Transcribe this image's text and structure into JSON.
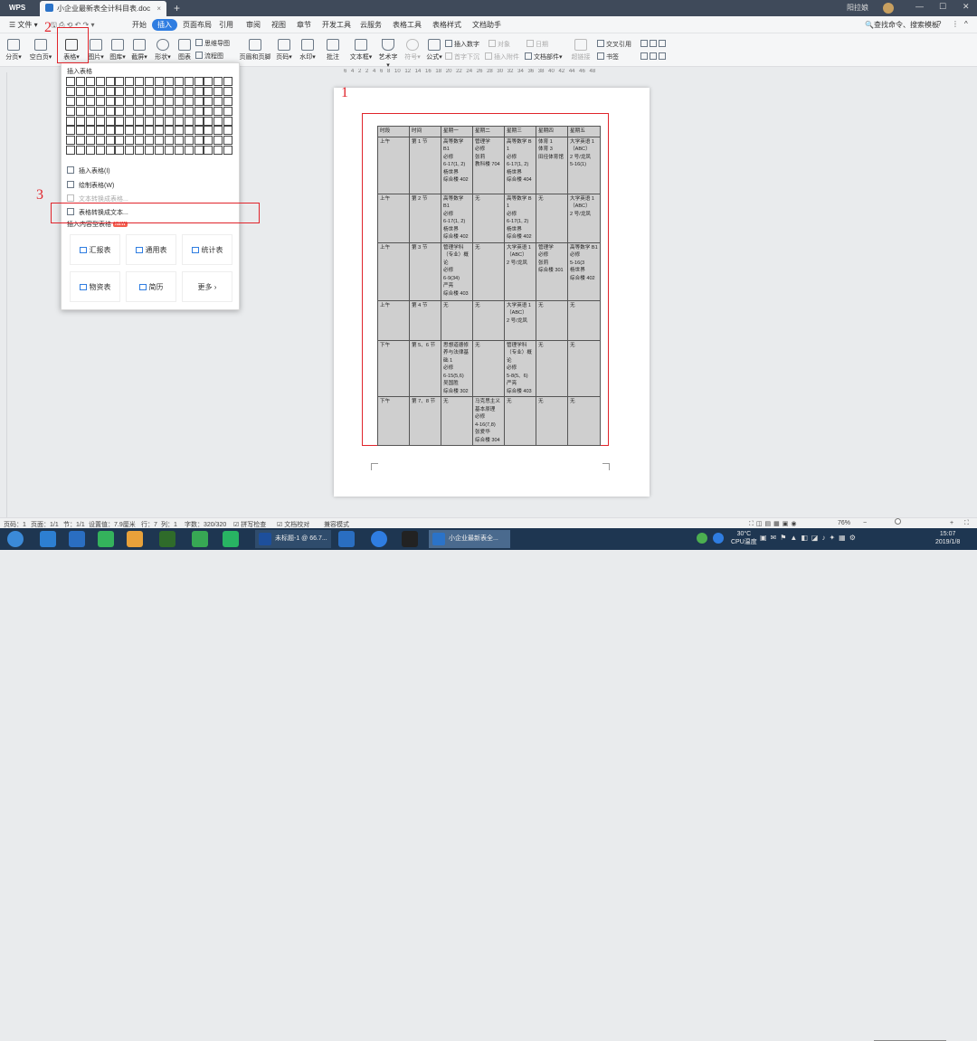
{
  "titlebar": {
    "app": "WPS",
    "doc_tab": "小企业最新表全计科目表.doc",
    "user": "阳拉娘"
  },
  "menu": [
    "文件",
    "开始",
    "插入",
    "页面布局",
    "引用",
    "审阅",
    "视图",
    "章节",
    "开发工具",
    "云服务",
    "表格工具",
    "表格样式",
    "文档助手"
  ],
  "search_box": "查找命令、搜索模板",
  "ribbon": {
    "big": [
      "分页",
      "空白页",
      "表格",
      "图片",
      "图库",
      "截屏",
      "形状",
      "图表",
      "页眉和页脚",
      "页码",
      "水印",
      "批注",
      "文本框",
      "艺术字",
      "符号",
      "公式"
    ],
    "small": [
      "思维导图",
      "流程图",
      "插入数字",
      "日期",
      "首字下沉",
      "插入附件",
      "对象",
      "文档部件",
      "超链接",
      "交叉引用",
      "书签"
    ]
  },
  "annotations": {
    "m1": "1",
    "m2": "2",
    "m3": "3"
  },
  "dropdown": {
    "title": "插入表格",
    "insert": "插入表格(I)",
    "draw": "绘制表格(W)",
    "text_to_table": "文本转换成表格...",
    "table_to_text": "表格转换成文本...",
    "content_table": "插入内容型表格",
    "badge": "NEW",
    "templates": [
      "汇报表",
      "通用表",
      "统计表",
      "物资表",
      "简历",
      "更多"
    ]
  },
  "table": {
    "header": [
      "时段",
      "时间",
      "星期一",
      "星期二",
      "星期三",
      "星期四",
      "星期五"
    ],
    "rows": [
      [
        "上午",
        "第 1 节",
        "高等数学\nB1\n必修\n6-17(1, 2)\n杨世界\n综合楼 402",
        "管理学\n必修\n张莉\n教科楼 704",
        "高等数学 B1\n必修\n6-17(1, 2)\n杨世界\n综合楼 404",
        "体育 1\n体育 3\n田径体育馆",
        "大学英语 1\n（ABC）\n2 号/龙凤\n5-16(1)"
      ],
      [
        "上午",
        "第 2 节",
        "高等数学\nB1\n必修\n6-17(1, 2)\n杨世界\n综合楼 402",
        "无",
        "高等数学 B1\n必修\n6-17(1, 2)\n杨世界\n综合楼 402",
        "无",
        "大学英语 1\n（ABC）\n2 号/龙凤"
      ],
      [
        "上午",
        "第 3 节",
        "管理学科\n（专业）概论\n必修\n6-9(34)\n严亮\n综合楼 403",
        "无",
        "大学英语 1\n（ABC）\n2 号/龙凤",
        "管理学\n必修\n张莉\n综合楼 301",
        "高等数学 B1\n必修\n5-16(3\n杨世界\n综合楼 402"
      ],
      [
        "上午",
        "第 4 节",
        "无",
        "无",
        "大学英语 1\n（ABC）\n2 号/龙凤",
        "无",
        "无"
      ],
      [
        "下午",
        "第 5、6 节",
        "思想道德修养与法律基础 1\n必修\n6-15(5,6)\n吴国胜\n综合楼 302",
        "无",
        "管理学科（专业）概论\n必修\n5-8(5、6)\n严亮\n综合楼 403",
        "无",
        "无"
      ],
      [
        "下午",
        "第 7、8 节",
        "无",
        "马克思主义基本原理\n必修\n4-16(7,8)\n张爱华\n综合楼 304",
        "无",
        "无",
        "无"
      ]
    ]
  },
  "ruler": "6 4 2 2 4 6 8 10 12 14 16 18 20 22 24 26 28 30 32 34 36 38 40 42 44 46 48",
  "status": {
    "page": "页码：1",
    "pages": "页面：1/1",
    "section": "节：1/1",
    "setting": "设置值：7.9厘米",
    "row": "行：7",
    "col": "列：1",
    "words": "字数：320/320",
    "spell": "拼写检查",
    "proof": "文档校对",
    "compat": "兼容模式",
    "zoom": "76%"
  },
  "taskbar": {
    "tasks": [
      "未标题-1 @ 66.7...",
      "小企业最新表全..."
    ],
    "temp": "30°C",
    "cpu": "CPU温度",
    "time": "15:07",
    "date": "2019/1/8"
  }
}
